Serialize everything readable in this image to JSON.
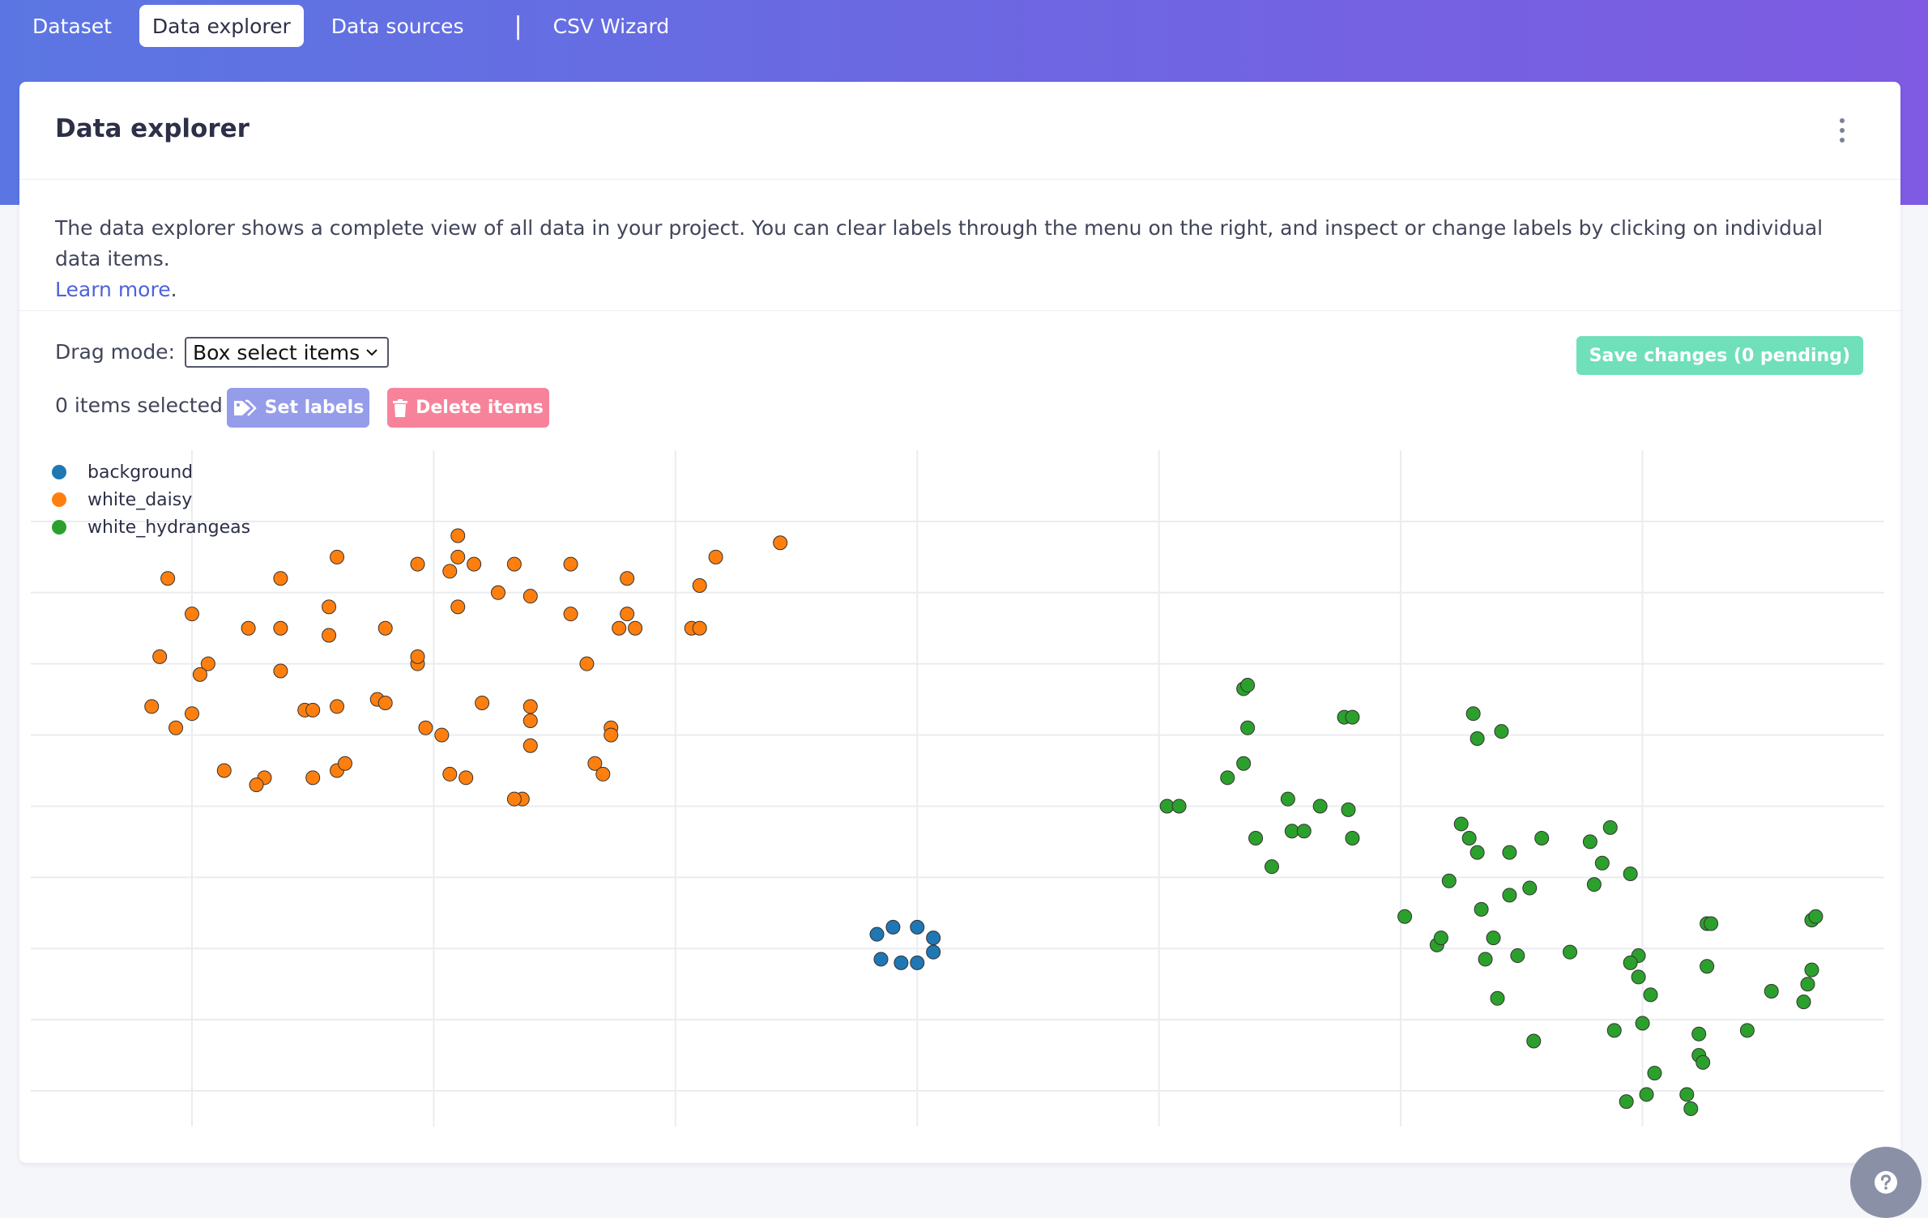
{
  "nav": {
    "tabs": [
      {
        "label": "Dataset",
        "active": false
      },
      {
        "label": "Data explorer",
        "active": true
      },
      {
        "label": "Data sources",
        "active": false
      }
    ],
    "separator": "|",
    "extra_tab": "CSV Wizard"
  },
  "card": {
    "title": "Data explorer",
    "description": "The data explorer shows a complete view of all data in your project. You can clear labels through the menu on the right, and inspect or change labels by clicking on individual data items.",
    "learn_more": "Learn more",
    "learn_more_suffix": "."
  },
  "controls": {
    "drag_mode_label": "Drag mode:",
    "drag_mode_value": "Box select items",
    "selected_text": "0 items selected",
    "set_labels": "Set labels",
    "delete_items": "Delete items",
    "save_changes": "Save changes (0 pending)"
  },
  "colors": {
    "background": "#1f77b4",
    "white_daisy": "#ff7f0e",
    "white_hydrangeas": "#2ca02c",
    "save_button": "#6fe0b9",
    "set_labels_button": "#959cea",
    "delete_button": "#f7839a"
  },
  "icons": {
    "menu": "kebab-menu-icon",
    "set_labels": "tag-icon",
    "delete_items": "trash-icon",
    "help": "help-icon"
  },
  "chart_data": {
    "type": "scatter",
    "grid": true,
    "legend_position": "top-left",
    "xlim": [
      0,
      23
    ],
    "ylim": [
      0,
      9.5
    ],
    "series": [
      {
        "name": "background",
        "color": "#1f77b4",
        "points": [
          [
            10.5,
            2.7
          ],
          [
            10.7,
            2.8
          ],
          [
            11.0,
            2.8
          ],
          [
            11.2,
            2.65
          ],
          [
            11.2,
            2.45
          ],
          [
            11.0,
            2.3
          ],
          [
            10.8,
            2.3
          ],
          [
            10.55,
            2.35
          ]
        ]
      },
      {
        "name": "white_daisy",
        "color": "#ff7f0e",
        "points": [
          [
            1.7,
            7.7
          ],
          [
            3.1,
            7.7
          ],
          [
            3.7,
            7.3
          ],
          [
            5.3,
            8.3
          ],
          [
            5.3,
            8.0
          ],
          [
            9.3,
            8.2
          ],
          [
            3.8,
            8.0
          ],
          [
            8.5,
            8.0
          ],
          [
            2.0,
            7.2
          ],
          [
            3.7,
            6.9
          ],
          [
            1.6,
            6.6
          ],
          [
            2.2,
            6.5
          ],
          [
            2.1,
            6.35
          ],
          [
            3.1,
            6.4
          ],
          [
            4.8,
            6.5
          ],
          [
            4.8,
            6.6
          ],
          [
            1.5,
            5.9
          ],
          [
            2.0,
            5.8
          ],
          [
            1.8,
            5.6
          ],
          [
            3.4,
            5.85
          ],
          [
            3.5,
            5.85
          ],
          [
            3.8,
            5.9
          ],
          [
            4.3,
            6.0
          ],
          [
            4.4,
            5.95
          ],
          [
            2.4,
            5.0
          ],
          [
            2.9,
            4.9
          ],
          [
            2.8,
            4.8
          ],
          [
            3.5,
            4.9
          ],
          [
            3.8,
            5.0
          ],
          [
            3.9,
            5.1
          ],
          [
            5.2,
            4.95
          ],
          [
            5.4,
            4.9
          ],
          [
            6.1,
            4.6
          ],
          [
            6.0,
            4.6
          ],
          [
            6.2,
            5.35
          ],
          [
            7.0,
            5.1
          ],
          [
            2.7,
            7.0
          ],
          [
            3.1,
            7.0
          ],
          [
            4.4,
            7.0
          ],
          [
            4.8,
            7.9
          ],
          [
            5.5,
            7.9
          ],
          [
            6.0,
            7.9
          ],
          [
            6.7,
            7.9
          ],
          [
            5.2,
            7.8
          ],
          [
            5.8,
            7.5
          ],
          [
            6.2,
            7.45
          ],
          [
            7.4,
            7.7
          ],
          [
            7.4,
            7.2
          ],
          [
            7.3,
            7.0
          ],
          [
            7.5,
            7.0
          ],
          [
            6.7,
            7.2
          ],
          [
            8.2,
            7.0
          ],
          [
            8.3,
            7.0
          ],
          [
            8.3,
            7.6
          ],
          [
            5.3,
            7.3
          ],
          [
            5.1,
            5.5
          ],
          [
            6.2,
            5.9
          ],
          [
            6.2,
            5.7
          ],
          [
            7.2,
            5.6
          ],
          [
            7.2,
            5.5
          ],
          [
            6.9,
            6.5
          ],
          [
            7.1,
            4.95
          ],
          [
            4.9,
            5.6
          ],
          [
            5.6,
            5.95
          ]
        ]
      },
      {
        "name": "white_hydrangeas",
        "color": "#2ca02c",
        "points": [
          [
            15.05,
            6.15
          ],
          [
            15.1,
            6.2
          ],
          [
            15.1,
            5.6
          ],
          [
            15.05,
            5.1
          ],
          [
            14.85,
            4.9
          ],
          [
            14.1,
            4.5
          ],
          [
            14.25,
            4.5
          ],
          [
            15.6,
            4.6
          ],
          [
            16.0,
            4.5
          ],
          [
            16.35,
            4.45
          ],
          [
            16.3,
            5.75
          ],
          [
            16.4,
            5.75
          ],
          [
            15.2,
            4.05
          ],
          [
            15.65,
            4.15
          ],
          [
            15.4,
            3.65
          ],
          [
            15.8,
            4.15
          ],
          [
            16.4,
            4.05
          ],
          [
            17.9,
            5.8
          ],
          [
            17.95,
            5.45
          ],
          [
            18.25,
            5.55
          ],
          [
            17.75,
            4.25
          ],
          [
            17.85,
            4.05
          ],
          [
            17.6,
            3.45
          ],
          [
            18.0,
            3.05
          ],
          [
            18.35,
            3.25
          ],
          [
            17.05,
            2.95
          ],
          [
            17.45,
            2.55
          ],
          [
            18.35,
            3.85
          ],
          [
            17.95,
            3.85
          ],
          [
            18.75,
            4.05
          ],
          [
            18.45,
            2.4
          ],
          [
            18.05,
            2.35
          ],
          [
            17.5,
            2.65
          ],
          [
            18.15,
            2.65
          ],
          [
            18.2,
            1.8
          ],
          [
            18.65,
            1.2
          ],
          [
            19.1,
            2.45
          ],
          [
            19.4,
            3.4
          ],
          [
            19.5,
            3.7
          ],
          [
            19.35,
            4.0
          ],
          [
            19.6,
            4.2
          ],
          [
            19.85,
            3.55
          ],
          [
            19.95,
            2.4
          ],
          [
            19.85,
            2.3
          ],
          [
            19.95,
            2.1
          ],
          [
            20.1,
            1.85
          ],
          [
            20.0,
            1.45
          ],
          [
            19.65,
            1.35
          ],
          [
            20.15,
            0.75
          ],
          [
            20.05,
            0.45
          ],
          [
            19.8,
            0.35
          ],
          [
            20.6,
            0.25
          ],
          [
            20.55,
            0.45
          ],
          [
            20.7,
            1.0
          ],
          [
            20.7,
            1.3
          ],
          [
            20.75,
            0.9
          ],
          [
            20.8,
            2.25
          ],
          [
            20.8,
            2.85
          ],
          [
            20.85,
            2.85
          ],
          [
            21.3,
            1.35
          ],
          [
            21.6,
            1.9
          ],
          [
            22.0,
            1.75
          ],
          [
            22.05,
            2.0
          ],
          [
            22.1,
            2.2
          ],
          [
            22.1,
            2.9
          ],
          [
            22.15,
            2.95
          ],
          [
            18.6,
            3.35
          ]
        ]
      }
    ]
  }
}
